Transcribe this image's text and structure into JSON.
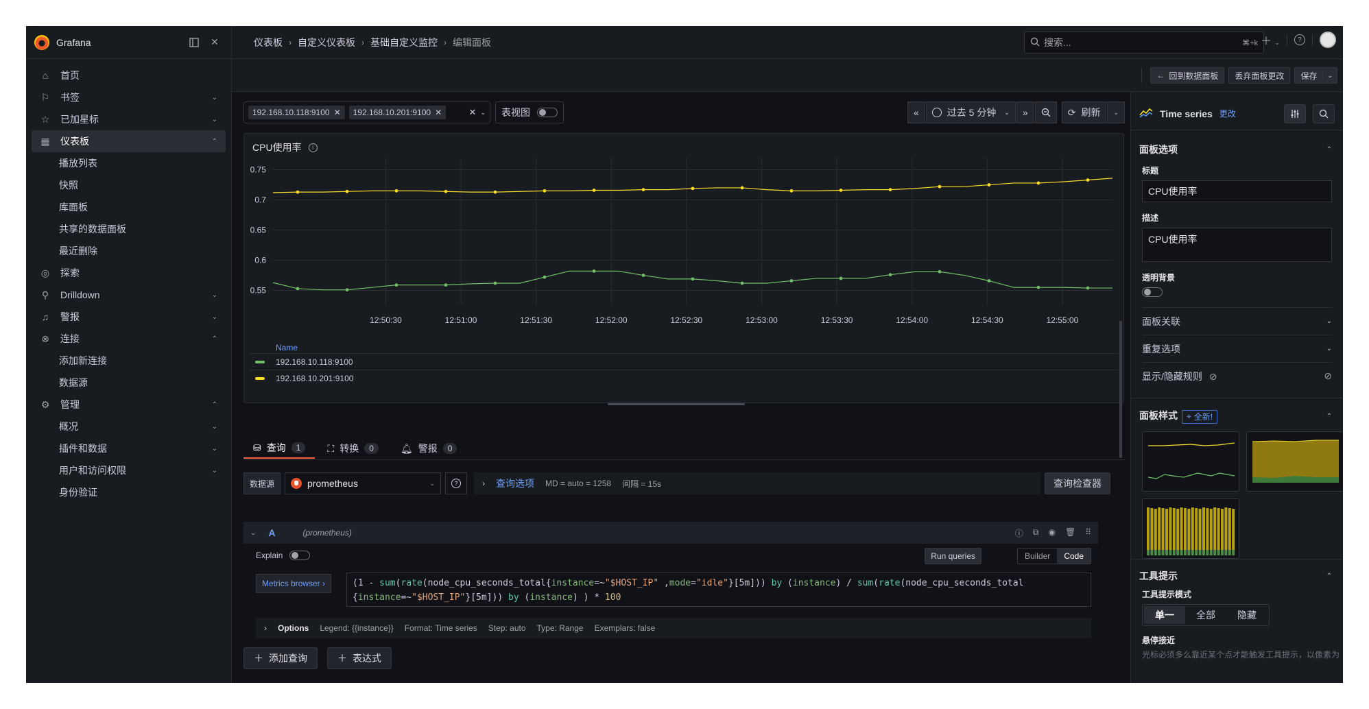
{
  "app": {
    "brand": "Grafana"
  },
  "sidebar": {
    "items": [
      {
        "label": "首页",
        "icon": "home-icon",
        "chevron": ""
      },
      {
        "label": "书签",
        "icon": "bookmark-icon",
        "chevron": "down"
      },
      {
        "label": "已加星标",
        "icon": "star-icon",
        "chevron": "down"
      },
      {
        "label": "仪表板",
        "icon": "apps-icon",
        "chevron": "up",
        "active": true,
        "children": [
          "播放列表",
          "快照",
          "库面板",
          "共享的数据面板",
          "最近删除"
        ]
      },
      {
        "label": "探索",
        "icon": "compass-icon",
        "chevron": ""
      },
      {
        "label": "Drilldown",
        "icon": "drilldown-icon",
        "chevron": "down"
      },
      {
        "label": "警报",
        "icon": "bell-icon",
        "chevron": "down"
      },
      {
        "label": "连接",
        "icon": "plug-icon",
        "chevron": "up",
        "children": [
          "添加新连接",
          "数据源"
        ]
      },
      {
        "label": "管理",
        "icon": "cog-icon",
        "chevron": "up",
        "children": [
          {
            "label": "概况",
            "chevron": "down"
          },
          {
            "label": "插件和数据",
            "chevron": "down"
          },
          {
            "label": "用户和访问权限",
            "chevron": "down"
          },
          {
            "label": "身份验证",
            "chevron": ""
          }
        ]
      }
    ]
  },
  "breadcrumb": [
    "仪表板",
    "自定义仪表板",
    "基础自定义监控",
    "编辑面板"
  ],
  "search": {
    "placeholder": "搜索...",
    "shortcut": "⌘+k"
  },
  "subbar": {
    "back_label": "回到数据面板",
    "discard_label": "丢弃面板更改",
    "save_label": "保存"
  },
  "variables": {
    "chips": [
      "192.168.10.118:9100",
      "192.168.10.201:9100"
    ],
    "table_view_label": "表视图"
  },
  "time": {
    "range_label": "过去 5 分钟",
    "refresh_label": "刷新"
  },
  "panel": {
    "title": "CPU使用率",
    "legend_header": "Name"
  },
  "chart_data": {
    "type": "line",
    "title": "CPU使用率",
    "x": [
      "12:50:10",
      "12:50:20",
      "12:50:30",
      "12:50:40",
      "12:50:50",
      "12:51:00",
      "12:51:10",
      "12:51:20",
      "12:51:30",
      "12:51:40",
      "12:51:50",
      "12:52:00",
      "12:52:10",
      "12:52:20",
      "12:52:30",
      "12:52:40",
      "12:52:50",
      "12:53:00",
      "12:53:10",
      "12:53:20",
      "12:53:30",
      "12:53:40",
      "12:53:50",
      "12:54:00",
      "12:54:10",
      "12:54:20",
      "12:54:30",
      "12:54:40",
      "12:54:50",
      "12:55:00",
      "12:55:10"
    ],
    "x_tick_labels": [
      "12:50:30",
      "12:51:00",
      "12:51:30",
      "12:52:00",
      "12:52:30",
      "12:53:00",
      "12:53:30",
      "12:54:00",
      "12:54:30",
      "12:55:00"
    ],
    "y_ticks": [
      0.55,
      0.6,
      0.65,
      0.7,
      0.75
    ],
    "ylim": [
      0.537,
      0.762
    ],
    "grid": true,
    "series": [
      {
        "name": "192.168.10.118:9100",
        "color": "#73bf69",
        "values": [
          0.563,
          0.553,
          0.551,
          0.551,
          0.555,
          0.559,
          0.559,
          0.559,
          0.561,
          0.562,
          0.562,
          0.572,
          0.582,
          0.582,
          0.582,
          0.575,
          0.569,
          0.569,
          0.566,
          0.562,
          0.562,
          0.566,
          0.57,
          0.57,
          0.57,
          0.576,
          0.581,
          0.581,
          0.575,
          0.566,
          0.555,
          0.555,
          0.555,
          0.554,
          0.554
        ]
      },
      {
        "name": "192.168.10.201:9100",
        "color": "#fade2a",
        "values": [
          0.712,
          0.713,
          0.713,
          0.714,
          0.715,
          0.715,
          0.715,
          0.714,
          0.713,
          0.713,
          0.714,
          0.715,
          0.715,
          0.716,
          0.716,
          0.717,
          0.717,
          0.719,
          0.72,
          0.72,
          0.717,
          0.715,
          0.715,
          0.716,
          0.717,
          0.717,
          0.719,
          0.722,
          0.722,
          0.725,
          0.728,
          0.728,
          0.73,
          0.733,
          0.736
        ]
      }
    ]
  },
  "tabs": [
    {
      "label": "查询",
      "count": "1",
      "icon": "database-icon"
    },
    {
      "label": "转换",
      "count": "0",
      "icon": "transform-icon"
    },
    {
      "label": "警报",
      "count": "0",
      "icon": "bell-icon"
    }
  ],
  "query": {
    "datasource_label": "数据源",
    "datasource": "prometheus",
    "options_link": "查询选项",
    "md": "MD = auto = 1258",
    "interval": "间隔 = 15s",
    "inspector_label": "查询检查器",
    "ref": "A",
    "ds_hint": "(prometheus)",
    "explain_label": "Explain",
    "run_label": "Run queries",
    "builder_label": "Builder",
    "code_label": "Code",
    "metrics_browser": "Metrics browser ›",
    "options_title": "Options",
    "options_items": [
      "Legend: {{instance}}",
      "Format: Time series",
      "Step: auto",
      "Type: Range",
      "Exemplars: false"
    ],
    "add_query_label": "添加查询",
    "expression_label": "表达式"
  },
  "right": {
    "viz_name": "Time series",
    "change_label": "更改",
    "panel_options": "面板选项",
    "title_label": "标题",
    "title_value": "CPU使用率",
    "desc_label": "描述",
    "desc_value": "CPU使用率",
    "transparent_label": "透明背景",
    "links_label": "面板关联",
    "repeat_label": "重复选项",
    "rules_label": "显示/隐藏规则",
    "styles_label": "面板样式",
    "new_badge": "全新!",
    "tooltip_label": "工具提示",
    "tooltip_mode_label": "工具提示模式",
    "tooltip_modes": [
      "单一",
      "全部",
      "隐藏"
    ],
    "hover_label": "悬停接近",
    "hover_desc": "光标必须多么靠近某个点才能触发工具提示，以像素为"
  }
}
